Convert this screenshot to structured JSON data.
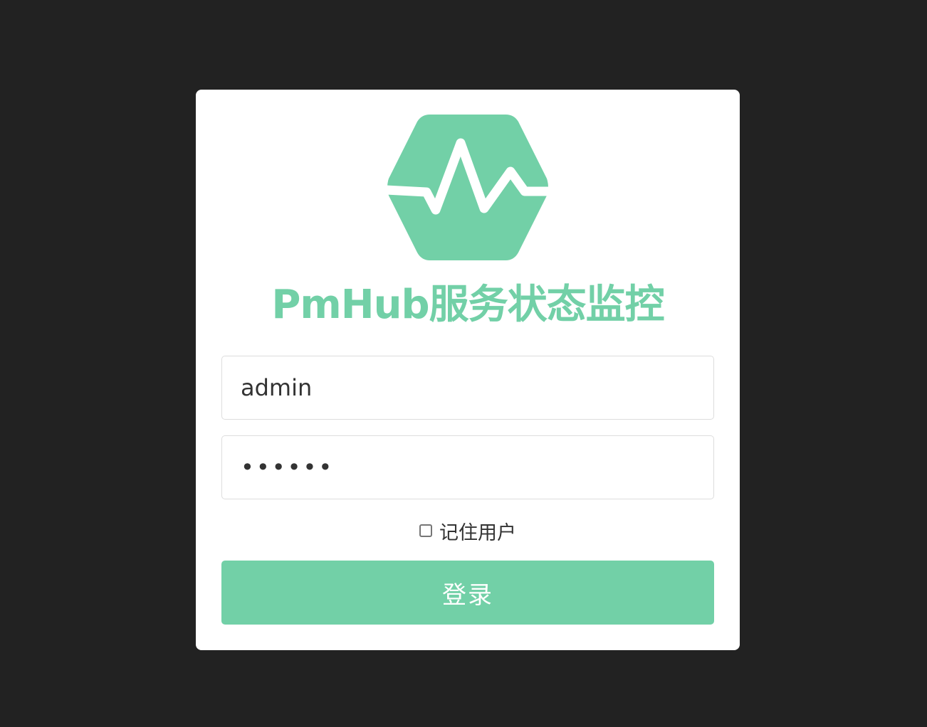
{
  "login": {
    "title": "PmHub服务状态监控",
    "username": {
      "value": "admin",
      "placeholder": ""
    },
    "password": {
      "value": "••••••",
      "placeholder": ""
    },
    "remember_label": "记住用户",
    "submit_label": "登录"
  },
  "colors": {
    "background": "#222222",
    "card": "#ffffff",
    "accent": "#72d0a7"
  },
  "icons": {
    "logo": "hexagon-heartbeat-icon",
    "checkbox": "checkbox-unchecked-icon"
  }
}
